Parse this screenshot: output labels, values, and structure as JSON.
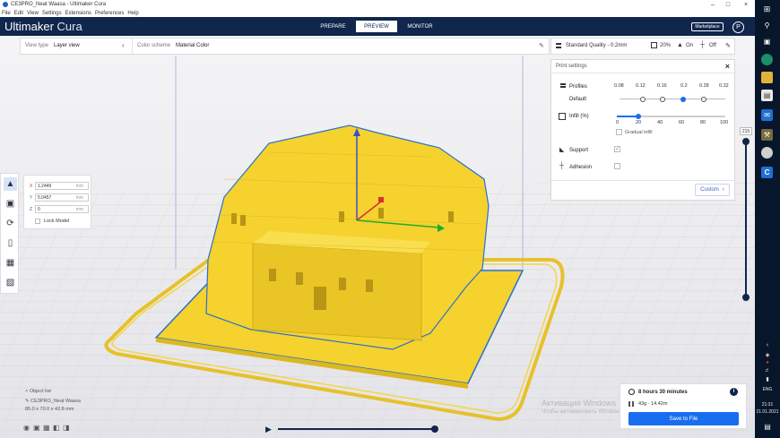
{
  "window": {
    "title": "CE3PRO_Neat Waasa - Ultimaker Cura"
  },
  "menu": [
    "File",
    "Edit",
    "View",
    "Settings",
    "Extensions",
    "Preferences",
    "Help"
  ],
  "header": {
    "logo_brand": "Ultimaker",
    "logo_product": "Cura",
    "tabs": [
      "PREPARE",
      "PREVIEW",
      "MONITOR"
    ],
    "active_tab": "PREVIEW",
    "marketplace_label": "Marketplace",
    "profile_initial": "P"
  },
  "view_bar": {
    "view_type_label": "View type",
    "view_type_value": "Layer view",
    "color_scheme_label": "Color scheme",
    "color_scheme_value": "Material Color"
  },
  "quality_bar": {
    "quality": "Standard Quality - 0.2mm",
    "infill": "20%",
    "support": "On",
    "adhesion": "Off"
  },
  "print_settings": {
    "title": "Print settings",
    "profiles_label": "Profiles",
    "profile_name": "Default",
    "layer_heights": [
      "0.08",
      "0.12",
      "0.16",
      "0.2",
      "0.28",
      "0.32"
    ],
    "selected_layer_height": "0.2",
    "infill_label": "Infill (%)",
    "infill_ticks": [
      "0",
      "20",
      "40",
      "60",
      "80",
      "100"
    ],
    "infill_value": 20,
    "gradual_infill_label": "Gradual infill",
    "support_label": "Support",
    "support_checked": true,
    "adhesion_label": "Adhesion",
    "adhesion_checked": false,
    "custom_label": "Custom"
  },
  "move_panel": {
    "x_label": "X",
    "x_value": "1.2449",
    "y_label": "Y",
    "y_value": "5.0457",
    "z_label": "Z",
    "z_value": "0",
    "unit": "mm",
    "lock_model_label": "Lock Model"
  },
  "object_list": {
    "title": "Object list",
    "object_name": "CE3PRO_Neat Waasa",
    "dimensions": "85.0 x 70.0 x 42.8 mm"
  },
  "layer_slider": {
    "max_layer": "215",
    "fill": 1.0
  },
  "simulation": {
    "progress": 1.0
  },
  "estimate": {
    "time": "8 hours 30 minutes",
    "material": "43g · 14.42m",
    "save_label": "Save to File"
  },
  "watermark": {
    "line1": "Активация Windows",
    "line2": "Чтобы активировать Windows, перейдите в раздел «Параметры»."
  },
  "taskbar": {
    "language": "ENG",
    "time": "21:31",
    "date": "21.01.2021"
  },
  "colors": {
    "header_bg": "#10264c",
    "accent_blue": "#196ef0",
    "model_yellow": "#f5d22e",
    "taskbar_bg": "#07162a"
  }
}
